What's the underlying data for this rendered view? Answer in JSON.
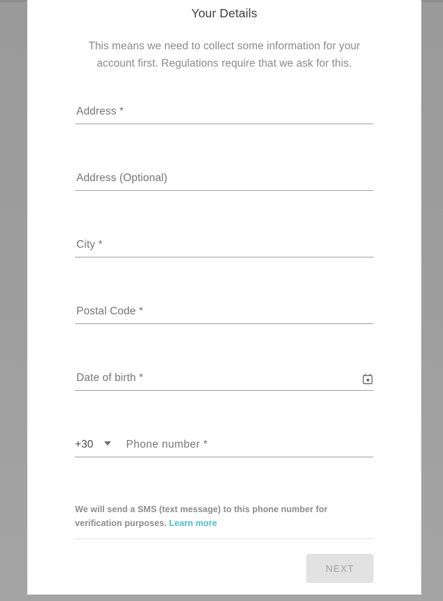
{
  "dialog": {
    "title": "Your Details",
    "subtitle": "This means we need to collect some information for your account first. Regulations require that we ask for this."
  },
  "form": {
    "fields": [
      {
        "name": "address",
        "placeholder": "Address *",
        "value": ""
      },
      {
        "name": "address-optional",
        "placeholder": "Address (Optional)",
        "value": ""
      },
      {
        "name": "city",
        "placeholder": "City *",
        "value": ""
      },
      {
        "name": "postal-code",
        "placeholder": "Postal Code *",
        "value": ""
      },
      {
        "name": "date-of-birth",
        "placeholder": "Date of birth *",
        "value": "",
        "icon": "calendar-icon"
      }
    ],
    "phone": {
      "country_code": "+30",
      "caret_icon": "chevron-down-icon",
      "placeholder": "Phone number *",
      "value": ""
    },
    "helper": {
      "text": "We will send a SMS (text message) to this phone number for verification purposes. ",
      "link_label": "Learn more"
    }
  },
  "footer": {
    "next_label": "NEXT"
  },
  "colors": {
    "link": "#4fbcc8",
    "backdrop": "#9b9b9b",
    "card": "#ffffff",
    "underline": "#9e9e9e",
    "button_bg": "#e2e2e2",
    "button_text": "#a0a0a0"
  }
}
